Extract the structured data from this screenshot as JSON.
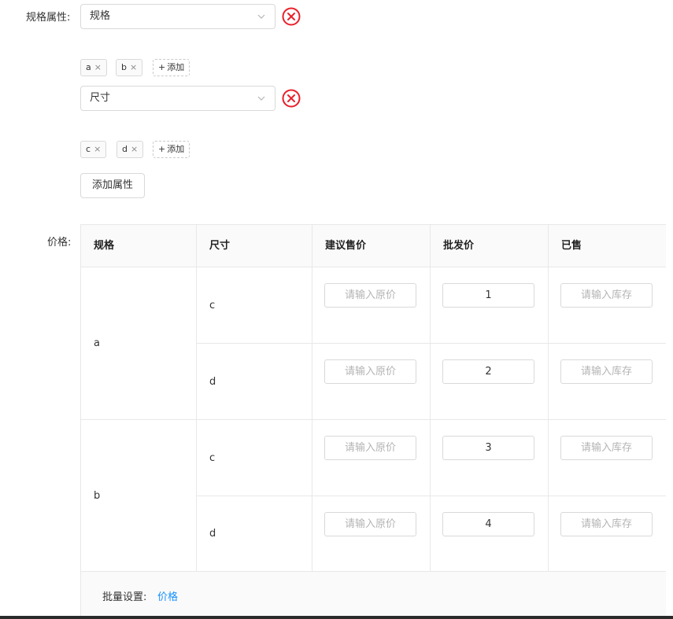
{
  "spec_attributes": {
    "label": "规格属性:",
    "groups": [
      {
        "selected": "规格",
        "tags": [
          "a",
          "b"
        ],
        "add_label": "添加"
      },
      {
        "selected": "尺寸",
        "tags": [
          "c",
          "d"
        ],
        "add_label": "添加"
      }
    ],
    "tag_remove_glyph": "×",
    "add_glyph": "+",
    "add_attribute_label": "添加属性",
    "remove_icon_color": "#e8202a"
  },
  "price": {
    "label": "价格:",
    "headers": [
      "规格",
      "尺寸",
      "建议售价",
      "批发价",
      "已售"
    ],
    "groups": [
      {
        "spec": "a",
        "rows": [
          {
            "size": "c",
            "suggested_placeholder": "请输入原价",
            "wholesale": "1",
            "sold_placeholder": "请输入库存"
          },
          {
            "size": "d",
            "suggested_placeholder": "请输入原价",
            "wholesale": "2",
            "sold_placeholder": "请输入库存"
          }
        ]
      },
      {
        "spec": "b",
        "rows": [
          {
            "size": "c",
            "suggested_placeholder": "请输入原价",
            "wholesale": "3",
            "sold_placeholder": "请输入库存"
          },
          {
            "size": "d",
            "suggested_placeholder": "请输入原价",
            "wholesale": "4",
            "sold_placeholder": "请输入库存"
          }
        ]
      }
    ],
    "batch": {
      "label": "批量设置:",
      "link": "价格"
    }
  },
  "colors": {
    "link": "#1890ff",
    "border": "#d9d9d9",
    "header_bg": "#fafafa"
  }
}
